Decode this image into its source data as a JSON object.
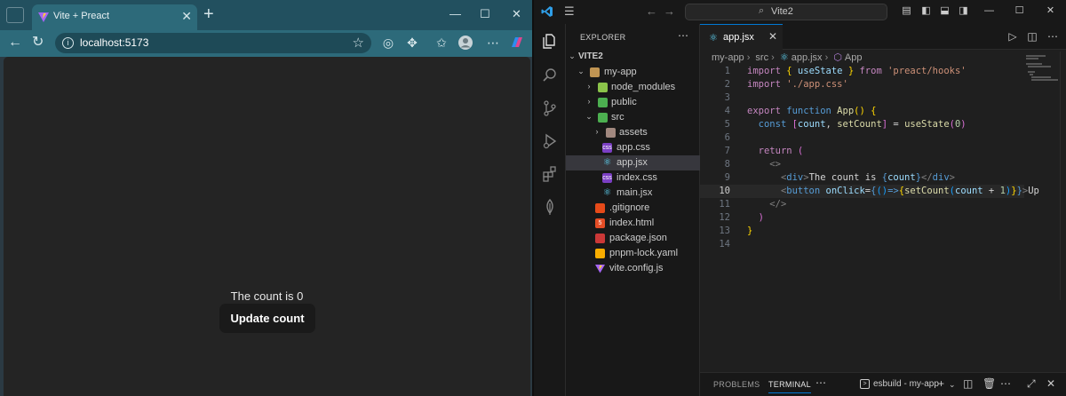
{
  "browser": {
    "tab_title": "Vite + Preact",
    "url": "localhost:5173",
    "page": {
      "count_text": "The count is 0",
      "button_label": "Update count"
    }
  },
  "vscode": {
    "search_text": "Vite2",
    "explorer_title": "EXPLORER",
    "root_folder": "VITE2",
    "tree": [
      {
        "label": "my-app",
        "chev": "⌄"
      },
      {
        "label": "node_modules",
        "chev": "›"
      },
      {
        "label": "public",
        "chev": "›"
      },
      {
        "label": "src",
        "chev": "⌄"
      },
      {
        "label": "assets",
        "chev": "›"
      },
      {
        "label": "app.css"
      },
      {
        "label": "app.jsx"
      },
      {
        "label": "index.css"
      },
      {
        "label": "main.jsx"
      },
      {
        "label": ".gitignore"
      },
      {
        "label": "index.html"
      },
      {
        "label": "package.json"
      },
      {
        "label": "pnpm-lock.yaml"
      },
      {
        "label": "vite.config.js"
      }
    ],
    "active_tab": "app.jsx",
    "breadcrumb": [
      "my-app",
      "src",
      "app.jsx",
      "App"
    ],
    "line_numbers": [
      "1",
      "2",
      "3",
      "4",
      "5",
      "6",
      "7",
      "8",
      "9",
      "10",
      "11",
      "12",
      "13",
      "14"
    ],
    "panel": {
      "problems": "PROBLEMS",
      "terminal": "TERMINAL",
      "terminal_name": "esbuild - my-app"
    }
  }
}
